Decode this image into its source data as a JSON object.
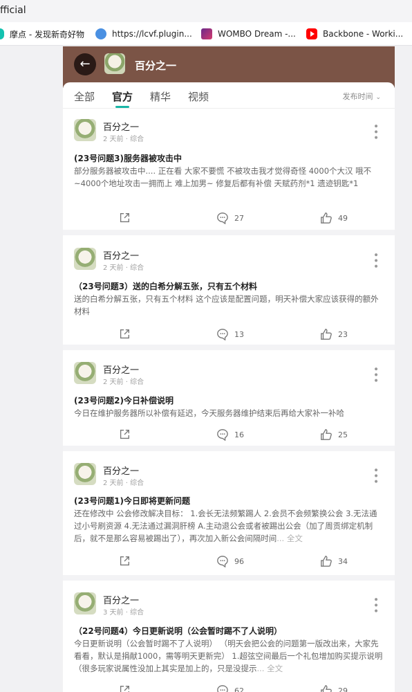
{
  "window_title": "fficial",
  "bookmarks": [
    {
      "label": "摩点 - 发现新奇好物",
      "icon": "moodian-icon"
    },
    {
      "label": "https://lcvf.plugin...",
      "icon": "globe-icon"
    },
    {
      "label": "WOMBO Dream -...",
      "icon": "wombo-icon"
    },
    {
      "label": "Backbone - Worki...",
      "icon": "youtube-icon"
    }
  ],
  "header": {
    "title": "百分之一",
    "back_icon": "arrow-left-icon"
  },
  "tabs": [
    {
      "label": "全部",
      "active": false
    },
    {
      "label": "官方",
      "active": true
    },
    {
      "label": "精华",
      "active": false
    },
    {
      "label": "视频",
      "active": false
    }
  ],
  "sort_label": "发布时间",
  "posts": [
    {
      "author": "百分之一",
      "meta": "2 天前 · 综合",
      "title": "(23号问题3)服务器被攻击中",
      "body": "部分服务器被攻击中.... 正在看 大家不要慌 不被攻击我才觉得奇怪 4000个大汉 哦不~4000个地址攻击一拥而上 难上加男~ 修复后都有补偿 天赋药剂*1 遗迹钥匙*1",
      "full": "",
      "comments": "27",
      "likes": "49"
    },
    {
      "author": "百分之一",
      "meta": "2 天前 · 综合",
      "title": "（23号问题3）送的白希分解五张，只有五个材料",
      "body": "送的白希分解五张，只有五个材料 这个应该是配置问题，明天补偿大家应该获得的额外材料",
      "full": "",
      "comments": "13",
      "likes": "23"
    },
    {
      "author": "百分之一",
      "meta": "2 天前 · 综合",
      "title": "(23号问题2)今日补偿说明",
      "body": "今日在维护服务器所以补偿有延迟，今天服务器维护结束后再给大家补一补哈",
      "full": "",
      "comments": "16",
      "likes": "25"
    },
    {
      "author": "百分之一",
      "meta": "2 天前 · 综合",
      "title": "(23号问题1)今日即将更新问题",
      "body": "还在修改中 公会修改解决目标： 1.会长无法频繁踢人 2.会员不会频繁换公会 3.无法通过小号刷资源 4.无法通过漏洞肝榜 A.主动退公会或者被踢出公会（加了周贡绑定机制后，就不是那么容易被踢出了），再次加入新公会间隔时间",
      "full": "... 全文",
      "comments": "96",
      "likes": "34"
    },
    {
      "author": "百分之一",
      "meta": "3 天前 · 综合",
      "title": "（22号问题4）今日更新说明（公会暂时踢不了人说明）",
      "body": "今日更新说明（公会暂时踢不了人说明） （明天会把公会的问题第一版改出来，大家先看看，默认是捐献1000，需等明天更新完） 1.超弦空间最后一个礼包增加购买提示说明（很多玩家说属性没加上其实是加上的，只是没提示",
      "full": "... 全文",
      "comments": "62",
      "likes": "29"
    }
  ],
  "colors": {
    "header_bg": "#7b5446",
    "accent": "#19b6a6",
    "page_bg": "#f1f1f3"
  }
}
